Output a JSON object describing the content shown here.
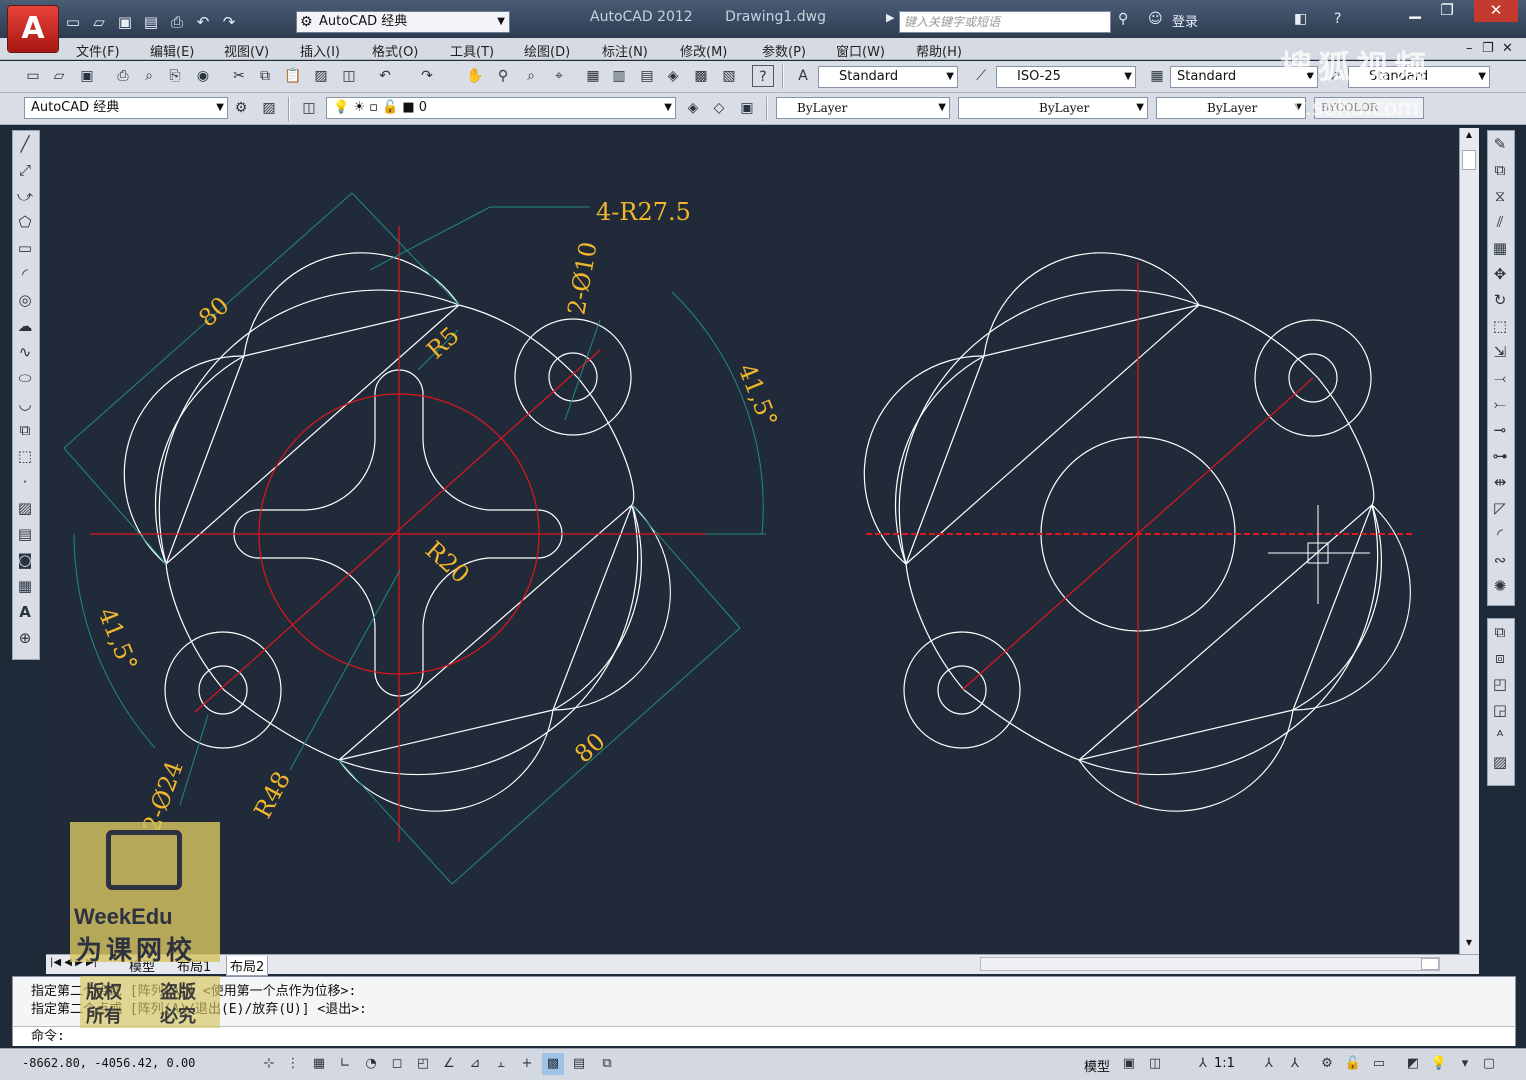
{
  "app": {
    "logo_letter": "A",
    "name": "AutoCAD 2012",
    "document": "Drawing1.dwg",
    "workspace": "AutoCAD 经典",
    "search_placeholder": "键入关键字或短语",
    "login": "登录"
  },
  "menu": [
    "文件(F)",
    "编辑(E)",
    "视图(V)",
    "插入(I)",
    "格式(O)",
    "工具(T)",
    "绘图(D)",
    "标注(N)",
    "修改(M)",
    "参数(P)",
    "窗口(W)",
    "帮助(H)"
  ],
  "styles": {
    "text_style": "Standard",
    "dim_style": "ISO-25",
    "table_style": "Standard",
    "multileader_style": "Standard"
  },
  "layers": {
    "workspace": "AutoCAD 经典",
    "current_layer": "0",
    "color": "ByLayer",
    "linetype": "ByLayer",
    "lineweight": "ByLayer",
    "plotstyle": "BYCOLOR"
  },
  "drawing": {
    "label_fillet": "4-R27.5",
    "label_hole_small": "2-Ø10",
    "label_len_top": "80",
    "label_len_bottom": "80",
    "label_r5": "R5",
    "label_r20": "R20",
    "label_angle_right": "41,5°",
    "label_angle_left": "41,5°",
    "label_hole_big": "2-Ø24",
    "label_r48": "R48"
  },
  "layout_tabs": [
    "模型",
    "布局1",
    "布局2"
  ],
  "command": {
    "line1": "指定第二个点或 [阵列(A)] <使用第一个点作为位移>:",
    "line2": "指定第二个点或 [阵列(A)/退出(E)/放弃(U)] <退出>:",
    "prompt": "命令:"
  },
  "status": {
    "coordinates": "-8662.80,  -4056.42, 0.00",
    "model_label": "模型",
    "scale": "1:1"
  },
  "watermarks": {
    "brand": "WeekEdu",
    "brand_cn": "为课网校",
    "cmd_mark_1": "版权",
    "cmd_mark_2": "所有",
    "cmd_mark_3": "盗版",
    "cmd_mark_4": "必究",
    "top_mark": "搜狐视频",
    "top_sub": "tv.sohu.com"
  },
  "colors": {
    "canvas": "#212a39",
    "geometry": "#ffffff",
    "centerline": "#e0161b",
    "dimension": "#f0b72c",
    "dimline": "#1f8a80"
  }
}
